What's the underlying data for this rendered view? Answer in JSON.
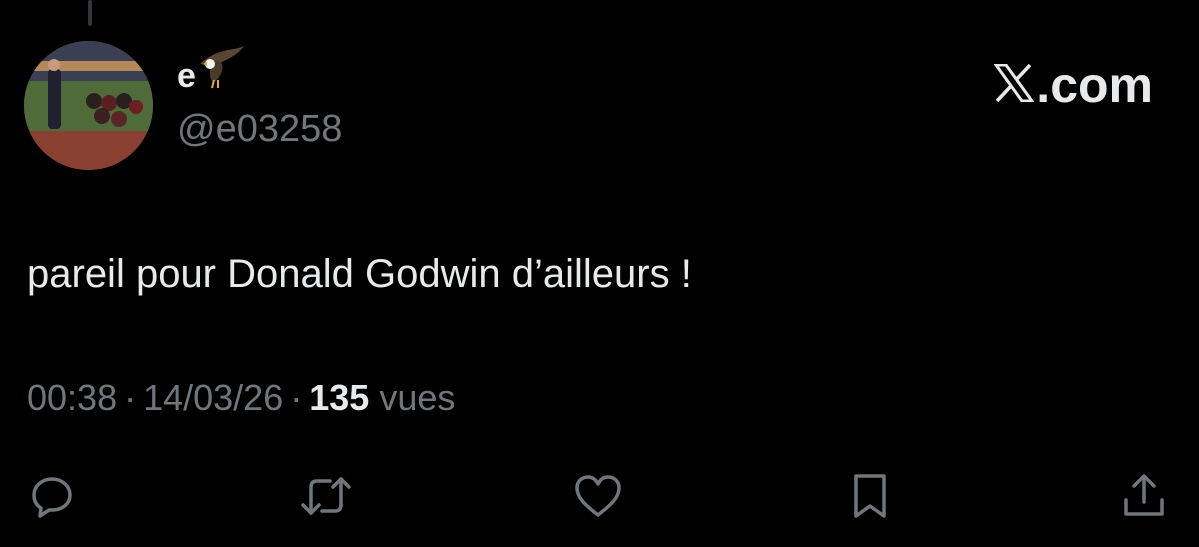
{
  "tweet": {
    "author": {
      "display_name": "e",
      "emoji_icon": "eagle-icon",
      "handle": "@e03258"
    },
    "brand": {
      "label": ".com",
      "icon": "x-logo-icon"
    },
    "text": "pareil pour Donald Godwin d’ailleurs !",
    "meta": {
      "time": "00:38",
      "separator": "·",
      "date": "14/03/26",
      "views_count": "135",
      "views_label": "vues"
    },
    "actions": [
      {
        "name": "reply",
        "icon": "reply-icon"
      },
      {
        "name": "retweet",
        "icon": "retweet-icon"
      },
      {
        "name": "like",
        "icon": "heart-icon"
      },
      {
        "name": "bookmark",
        "icon": "bookmark-icon"
      },
      {
        "name": "share",
        "icon": "share-icon"
      }
    ]
  },
  "colors": {
    "background": "#000000",
    "primary_text": "#e7e9ea",
    "secondary_text": "#71767b",
    "thread_line": "#333639"
  }
}
